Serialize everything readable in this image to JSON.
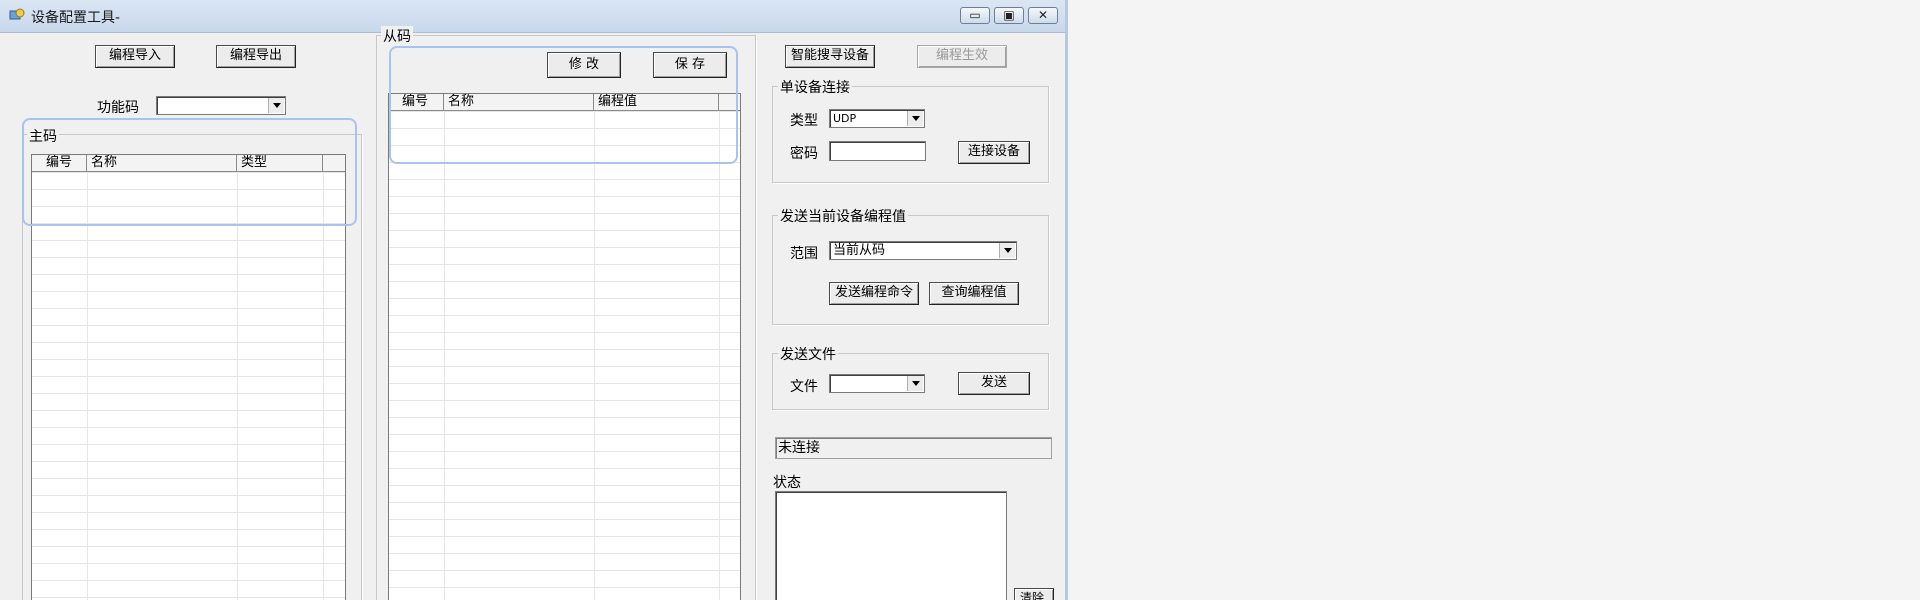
{
  "window": {
    "title": "设备配置工具-",
    "controls": {
      "minimize": "▭",
      "restore": "▣",
      "close": "✕"
    }
  },
  "left": {
    "import_button": "编程导入",
    "export_button": "编程导出",
    "function_code_label": "功能码",
    "function_code_value": "",
    "master_group_label": "主码",
    "master_columns": [
      "编号",
      "名称",
      "类型"
    ]
  },
  "middle": {
    "slave_group_label": "从码",
    "modify_button": "修 改",
    "save_button": "保 存",
    "slave_columns": [
      "编号",
      "名称",
      "编程值"
    ]
  },
  "right": {
    "smart_search_button": "智能搜寻设备",
    "apply_button": "编程生效",
    "single_device_group": "单设备连接",
    "type_label": "类型",
    "type_value": "UDP",
    "password_label": "密码",
    "connect_button": "连接设备",
    "send_values_group": "发送当前设备编程值",
    "range_label": "范围",
    "range_value": "当前从码",
    "send_command_button": "发送编程命令",
    "query_button": "查询编程值",
    "send_file_group": "发送文件",
    "file_label": "文件",
    "file_value": "",
    "send_button": "发送",
    "connection_status": "未连接",
    "status_label": "状态",
    "clear_button": "清除"
  }
}
